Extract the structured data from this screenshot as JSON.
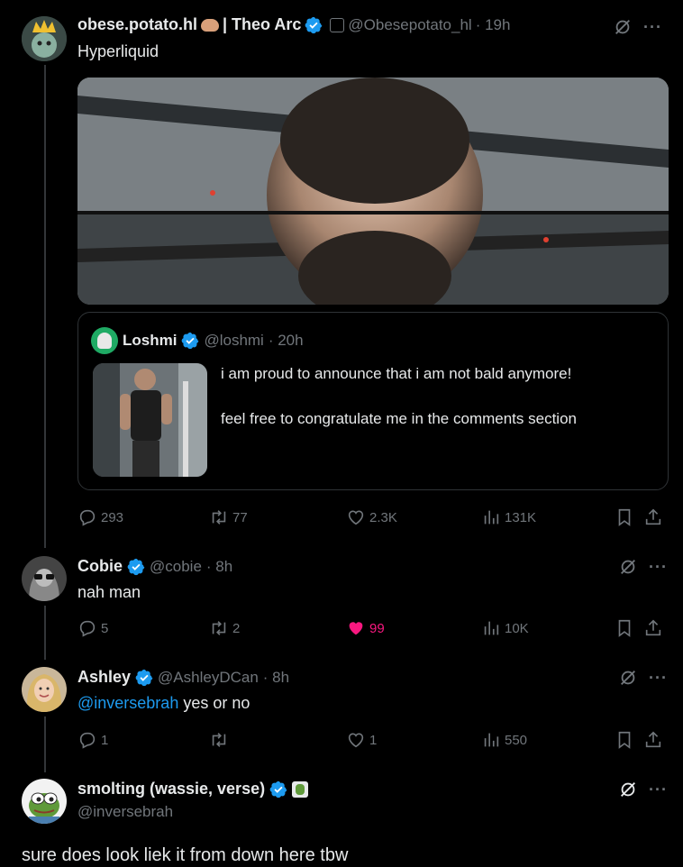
{
  "tweets": [
    {
      "display_name": "obese.potato.hl",
      "affiliation": "| Theo Arc",
      "handle": "@Obesepotato_hl",
      "time": "· 19h",
      "text": "Hyperliquid",
      "quote": {
        "display_name": "Loshmi",
        "handle": "@loshmi",
        "time": "· 20h",
        "line1": "i am proud to announce that i am not bald anymore!",
        "line2": "feel free to congratulate me in the comments section"
      },
      "actions": {
        "replies": "293",
        "reposts": "77",
        "likes": "2.3K",
        "views": "131K"
      }
    },
    {
      "display_name": "Cobie",
      "handle": "@cobie",
      "time": "· 8h",
      "text": "nah man",
      "actions": {
        "replies": "5",
        "reposts": "2",
        "likes": "99",
        "views": "10K"
      }
    },
    {
      "display_name": "Ashley",
      "handle": "@AshleyDCan",
      "time": "· 8h",
      "mention": "@inversebrah",
      "text": "yes or no",
      "actions": {
        "replies": "1",
        "reposts": "",
        "likes": "1",
        "views": "550"
      }
    },
    {
      "display_name": "smolting (wassie, verse)",
      "handle": "@inversebrah",
      "text": "sure does look liek it from down here tbw"
    }
  ],
  "colors": {
    "background": "#000000",
    "verified": "#1d9bf0",
    "like_active": "#f91880",
    "muted": "#71767b"
  },
  "icons": [
    "reply-icon",
    "repost-icon",
    "like-icon",
    "views-icon",
    "bookmark-icon",
    "share-icon",
    "grok-icon",
    "more-icon",
    "verified-icon"
  ]
}
